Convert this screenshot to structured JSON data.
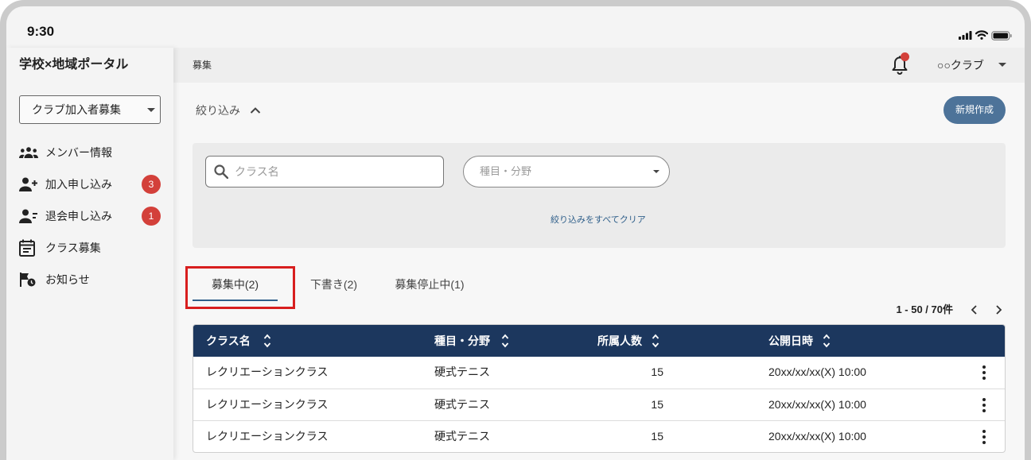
{
  "status_bar": {
    "time": "9:30",
    "icons": [
      "signal-icon",
      "wifi-icon",
      "battery-icon"
    ]
  },
  "sidebar": {
    "title": "学校×地域ポータル",
    "selector": {
      "value": "クラブ加入者募集",
      "icon": "caret-down-icon"
    },
    "items": [
      {
        "label": "メンバー情報",
        "icon": "members-icon"
      },
      {
        "label": "加入申し込み",
        "icon": "person-add-icon",
        "badge": "3"
      },
      {
        "label": "退会申し込み",
        "icon": "person-remove-icon",
        "badge": "1"
      },
      {
        "label": "クラス募集",
        "icon": "calendar-icon"
      },
      {
        "label": "お知らせ",
        "icon": "notice-icon"
      }
    ]
  },
  "header": {
    "breadcrumb": "募集",
    "notification_icon": "bell-icon",
    "has_unread": true,
    "account": "○○クラブ"
  },
  "filter": {
    "toggle_label": "絞り込み",
    "expanded": true,
    "search": {
      "placeholder": "クラス名"
    },
    "category": {
      "placeholder": "種目・分野"
    },
    "clear_label": "絞り込みをすべてクリア"
  },
  "actions": {
    "create_label": "新規作成"
  },
  "tabs": [
    {
      "label": "募集中(2)",
      "active": true
    },
    {
      "label": "下書き(2)",
      "active": false
    },
    {
      "label": "募集停止中(1)",
      "active": false
    }
  ],
  "pagination": {
    "range": "1 - 50 / 70件"
  },
  "table": {
    "columns": [
      "クラス名",
      "種目・分野",
      "所属人数",
      "公開日時"
    ],
    "rows": [
      {
        "name": "レクリエーションクラス",
        "category": "硬式テニス",
        "members": "15",
        "published": "20xx/xx/xx(X) 10:00"
      },
      {
        "name": "レクリエーションクラス",
        "category": "硬式テニス",
        "members": "15",
        "published": "20xx/xx/xx(X) 10:00"
      },
      {
        "name": "レクリエーションクラス",
        "category": "硬式テニス",
        "members": "15",
        "published": "20xx/xx/xx(X) 10:00"
      }
    ]
  },
  "colors": {
    "table_header": "#1c375e",
    "badge": "#d3403a",
    "primary_button": "#4d7399",
    "accent": "#2f5f8a",
    "highlight": "#d81e1e"
  }
}
